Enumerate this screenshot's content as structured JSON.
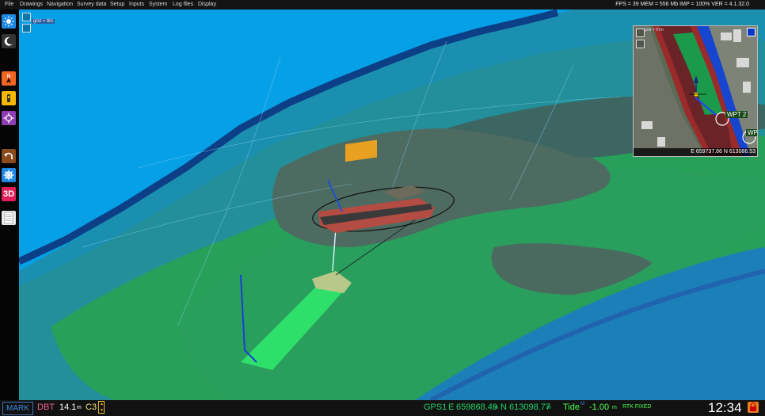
{
  "menu": {
    "items": [
      "File",
      "Drawings",
      "Navigation",
      "Survey data",
      "Setup",
      "Inputs",
      "System",
      "Log files",
      "Display"
    ],
    "status": "FPS = 39 MEM = 556 Mb IMP = 100% VER = 4.1.32.0"
  },
  "toolbar": {
    "items": [
      {
        "name": "day-mode-icon",
        "color": "#1e88e5"
      },
      {
        "name": "night-mode-icon",
        "color": "#333333"
      },
      {
        "name": "north-up-icon",
        "color": "#f26522"
      },
      {
        "name": "vessel-icon",
        "color": "#f5b800"
      },
      {
        "name": "center-icon",
        "color": "#8e3fb3"
      },
      {
        "name": "undo-icon",
        "color": "#8b4a1c"
      },
      {
        "name": "settings-icon",
        "color": "#1e88e5"
      },
      {
        "name": "3d-icon",
        "color": "#e01e5a",
        "label": "3D"
      },
      {
        "name": "notes-icon",
        "color": "#e8e8e8"
      }
    ]
  },
  "scene": {
    "grid_label": "grid = 8m"
  },
  "minimap": {
    "grid_label": "grid = 97m",
    "waypoint_label": "WPT 2",
    "waypoint2_label": "WPT",
    "coords": "E 659737.66 N 613086.53"
  },
  "statusbar": {
    "mark": "MARK",
    "dbt_label": "DBT",
    "dbt_value": "14.1",
    "dbt_unit": "m",
    "c3_label": "C3",
    "gps_label": "GPS1",
    "e_label": "E",
    "e_value": "659868.49",
    "e_unit": "m",
    "n_label": "N",
    "n_value": "613098.77",
    "n_unit": "m",
    "tide_label": "Tide",
    "tide_sup": "M",
    "tide_value": "-1.00",
    "tide_unit": "m",
    "rtk": "RTK FIXED",
    "clock": "12:34"
  },
  "colors": {
    "water": "#06a0e6",
    "sea_dark": "#0e6aa3",
    "green_shallow": "#1f9a55",
    "dredge_area": "#2ee06a",
    "mark": "#3a8ae0",
    "dbt": "#f06090",
    "gps": "#1fd26a",
    "tide": "#4cff4c",
    "clock": "#ffffff"
  }
}
